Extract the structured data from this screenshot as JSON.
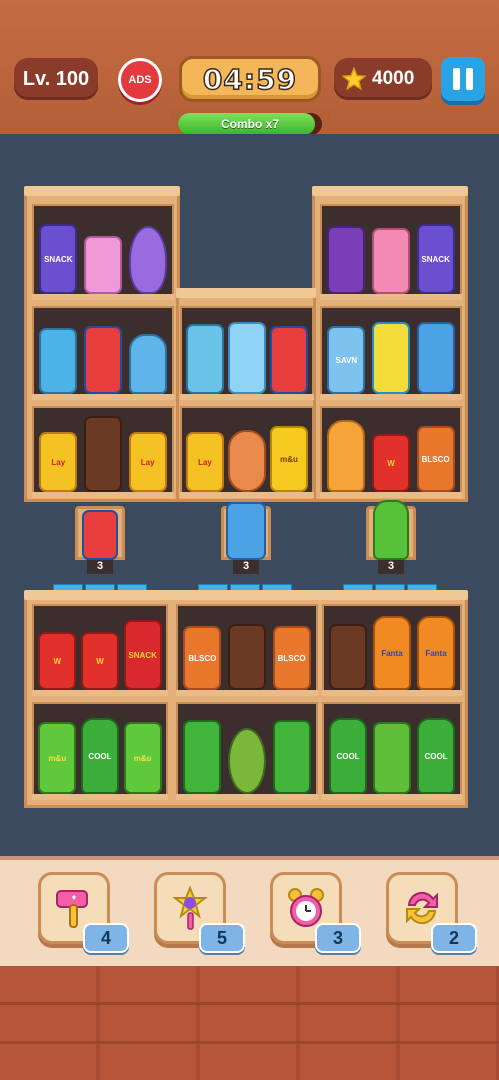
{
  "hud": {
    "level_label": "Lv. 100",
    "ads_label": "ADS",
    "timer": "04:59",
    "coins": "4000",
    "combo_label": "Combo x7",
    "combo_progress": 0.95
  },
  "stands": [
    {
      "count": "3",
      "item": "cola-can"
    },
    {
      "count": "3",
      "item": "milk-carton"
    },
    {
      "count": "3",
      "item": "green-soda-bottle"
    }
  ],
  "shelves_top": {
    "left_top": [
      "chips-can-snack",
      "tissue-box",
      "easter-egg-candy"
    ],
    "right_top": [
      "grape-juice-bottle",
      "pink-gift-bottle",
      "chips-can-snack"
    ],
    "row2": [
      [
        "blue-gift-bottle",
        "cola-can",
        "blue-popsicle"
      ],
      [
        "coffee-cup",
        "water-bottle",
        "cola-can"
      ],
      [
        "dish-soap-bottle",
        "yellow-juice-box",
        "milk-carton"
      ]
    ],
    "row3": [
      [
        "lays-chips",
        "chocolate-bar",
        "lays-chips"
      ],
      [
        "lays-chips",
        "hot-dog",
        "mm-bag"
      ],
      [
        "orange-popsicle",
        "fries",
        "orange-chips-bag"
      ]
    ]
  },
  "item_labels": {
    "snack": "SNACK",
    "lay": "Lay",
    "mm": "m&u",
    "cool": "COOL",
    "fanta": "Fanta",
    "w": "W",
    "savn": "SAVN",
    "bosco": "BLSCO"
  },
  "shelves_bottom": {
    "row1": [
      [
        "fries",
        "fries",
        "chips-can-snack"
      ],
      [
        "orange-chips-bag",
        "chocolate-bar",
        "orange-chips-bag"
      ],
      [
        "chocolate-bar",
        "orange-soda-bottle",
        "orange-soda-bottle"
      ]
    ],
    "row2": [
      [
        "mm-bag-green",
        "green-soda-bottle",
        "mm-bag-green"
      ],
      [
        "green-gift-bottle",
        "avocado",
        "green-gift-bottle"
      ],
      [
        "green-soda-bottle",
        "green-gift-box",
        "green-soda-bottle"
      ]
    ]
  },
  "boosters": [
    {
      "name": "hammer",
      "count": "4"
    },
    {
      "name": "magic-wand",
      "count": "5"
    },
    {
      "name": "alarm-clock",
      "count": "3"
    },
    {
      "name": "shuffle",
      "count": "2"
    }
  ],
  "colors": {
    "wood": "#e3b07a",
    "shelf_bg": "#3b2e2c",
    "board_bg": "#3c4a5e",
    "hud_bg": "#b9643d",
    "accent_blue": "#2aa3e6"
  }
}
